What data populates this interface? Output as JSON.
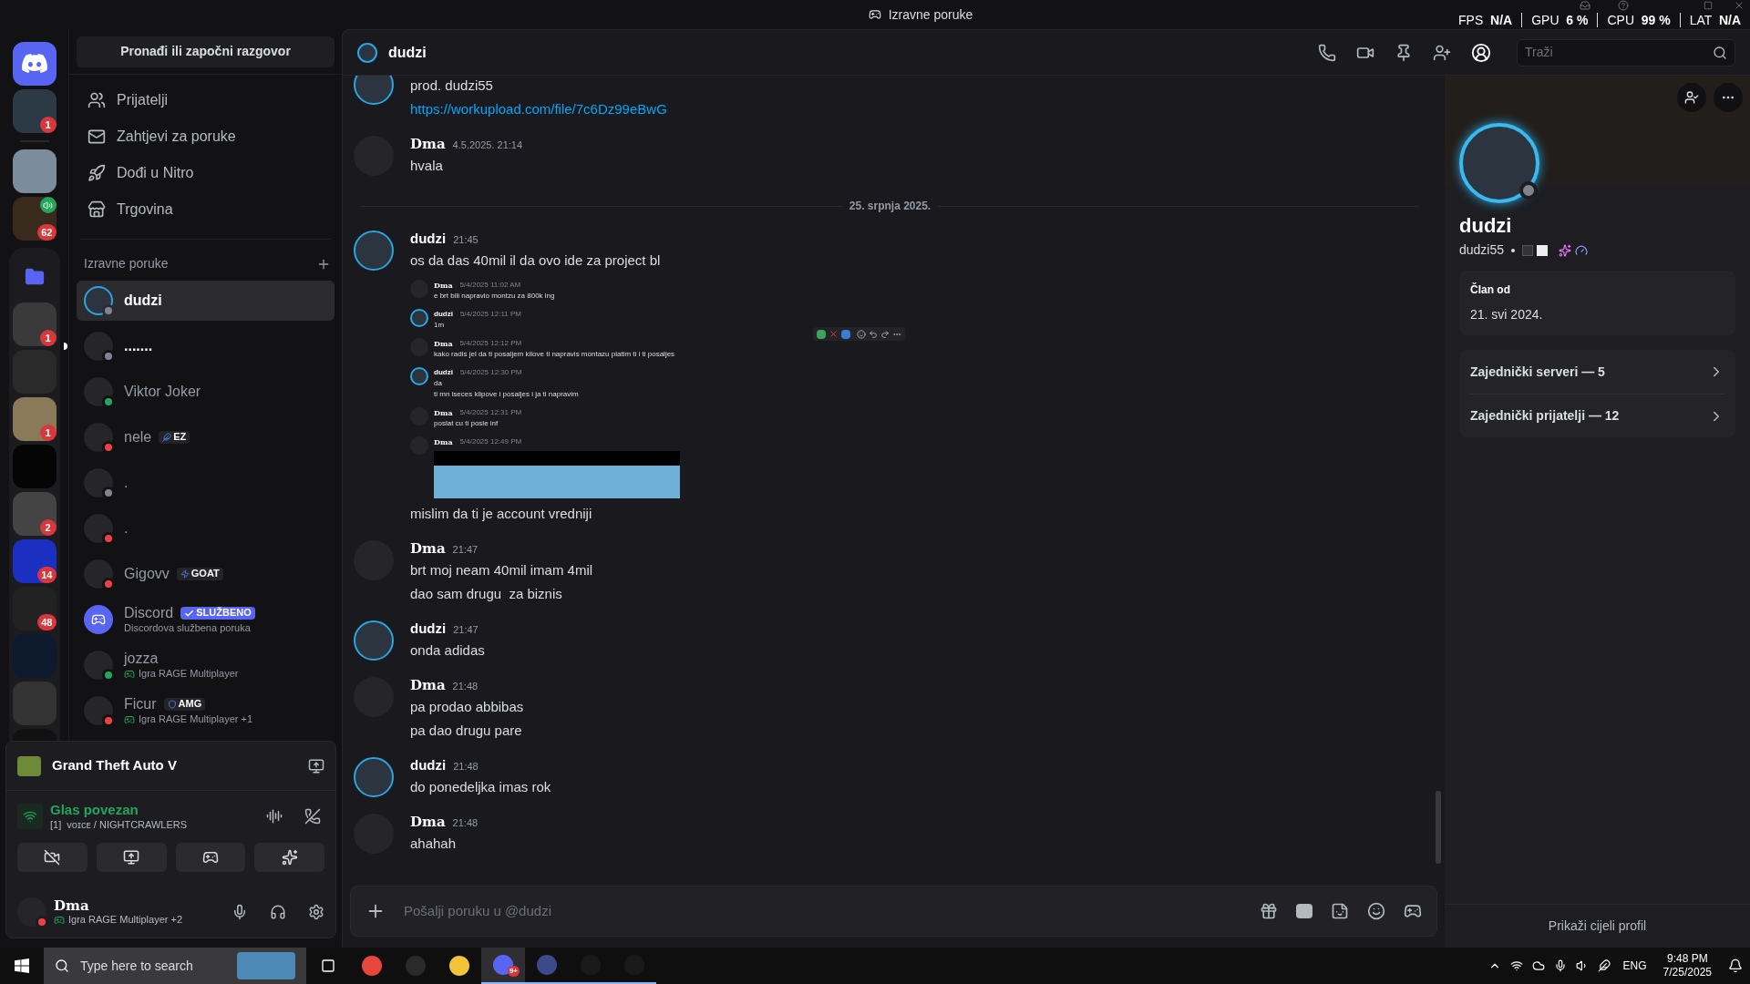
{
  "title_bar": {
    "title": "Izravne poruke"
  },
  "overlay": [
    {
      "label": "FPS",
      "value": "N/A"
    },
    {
      "label": "GPU",
      "value": "6 %"
    },
    {
      "label": "CPU",
      "value": "99 %"
    },
    {
      "label": "LAT",
      "value": "N/A"
    }
  ],
  "servers": [
    {
      "badge": "1",
      "voice": false,
      "color": "#2b3a44"
    },
    {
      "voice": false,
      "color": "#7c8c9c"
    },
    {
      "badge": "62",
      "voice": true,
      "color": "#3a2a1e"
    }
  ],
  "folder": {
    "servers": [
      {
        "badge": "1",
        "voice": false,
        "color": "#3a3a3a"
      },
      {
        "voice": false,
        "color": "#2a2a2a"
      },
      {
        "badge": "1",
        "voice": false,
        "color": "#8a7a5a"
      },
      {
        "voice": false,
        "color": "#050505"
      },
      {
        "badge": "2",
        "voice": false,
        "color": "#444444"
      },
      {
        "badge": "14",
        "voice": false,
        "color": "#1b2fc0"
      },
      {
        "badge": "48",
        "voice": false,
        "color": "#222222"
      },
      {
        "voice": false,
        "color": "#0d1a2e"
      },
      {
        "voice": false,
        "color": "#333333"
      },
      {
        "voice": false,
        "color": "#111111"
      }
    ]
  },
  "dm_panel": {
    "search_button": "Pronađi ili započni razgovor",
    "nav": [
      {
        "label": "Prijatelji"
      },
      {
        "label": "Zahtjevi za poruke"
      },
      {
        "label": "Dođi u Nitro"
      },
      {
        "label": "Trgovina"
      }
    ],
    "section_title": "Izravne poruke",
    "conversations": [
      {
        "name": "dudzi",
        "selected": true,
        "unread": false,
        "color": "#80848e",
        "ring": true
      },
      {
        "name": ".......",
        "selected": false,
        "unread": true,
        "color": "#80848e",
        "ring": false
      },
      {
        "name": "Viktor Joker",
        "selected": false,
        "unread": false,
        "color": "#23a55a",
        "ring": false
      },
      {
        "name": "nele",
        "selected": false,
        "unread": false,
        "color": "#f23f43",
        "ring": false,
        "tag": {
          "kind": "guild",
          "text": "EZ"
        }
      },
      {
        "name": ".",
        "selected": false,
        "unread": false,
        "color": "#80848e",
        "ring": false
      },
      {
        "name": ".",
        "selected": false,
        "unread": false,
        "color": "#f23f43",
        "ring": false
      },
      {
        "name": "Gigovv",
        "selected": false,
        "unread": false,
        "color": "#f23f43",
        "ring": false,
        "tag": {
          "kind": "guild",
          "text": "GOAT"
        }
      },
      {
        "name": "Discord",
        "selected": false,
        "unread": false,
        "tag": {
          "kind": "official",
          "text": "SLUŽBENO"
        },
        "subtitle": "Discordova službena poruka"
      },
      {
        "name": "jozza",
        "selected": false,
        "unread": false,
        "color": "#23a55a",
        "ring": false,
        "activity": "Igra RAGE Multiplayer"
      },
      {
        "name": "Ficur",
        "selected": false,
        "unread": false,
        "color": "#f23f43",
        "ring": false,
        "tag": {
          "kind": "guild",
          "text": "AMG"
        },
        "activity": "Igra RAGE Multiplayer +1"
      }
    ]
  },
  "activity_panel": {
    "game": "Grand Theft Auto V",
    "voice_status": "Glas povezan",
    "channel": "[1]  ᴠᴏɪᴄᴇ / NIGHTCRAWLERS"
  },
  "user_panel": {
    "name": "Dma",
    "color": "#f23f43",
    "activity": "Igra RAGE Multiplayer +2"
  },
  "chat": {
    "header": {
      "name": "dudzi",
      "search_placeholder": "Traži"
    },
    "groups": [
      {
        "kind": "continued",
        "ring": true,
        "lines": [
          {
            "kind": "text",
            "text": "prod. dudzi55"
          },
          {
            "kind": "link",
            "text": "https://workupload.com/file/7c6Dz99eBwG"
          }
        ]
      },
      {
        "kind": "message",
        "author": "Dma",
        "fancy": true,
        "ring": false,
        "time": "4.5.2025. 21:14",
        "lines": [
          {
            "kind": "text",
            "text": "hvala"
          }
        ]
      },
      {
        "kind": "divider",
        "text": "25. srpnja 2025."
      },
      {
        "kind": "message",
        "author": "dudzi",
        "fancy": false,
        "ring": true,
        "time": "21:45",
        "lines": [
          {
            "kind": "text",
            "text": "os da das 40mil il da ovo ide za project bl"
          },
          {
            "kind": "screenshot",
            "messages": [
              {
                "author": "Dma",
                "fancy": true,
                "ring": false,
                "time": "5/4/2025 11:02 AM",
                "lines": [
                  "e brt bili napravio montzu za 800k ing"
                ]
              },
              {
                "author": "dudzi",
                "fancy": false,
                "ring": true,
                "time": "5/4/2025 12:11 PM",
                "lines": [
                  "1m"
                ]
              },
              {
                "author": "Dma",
                "fancy": true,
                "ring": false,
                "time": "5/4/2025 12:12 PM",
                "lines": [
                  "kako radis jel da ti posaljem kilove ti napravis montazu platim ti i ti posaljes"
                ]
              },
              {
                "author": "dudzi",
                "fancy": false,
                "ring": true,
                "time": "5/4/2025 12:30 PM",
                "lines": [
                  "da",
                  "ti mn iseces klipove i posaljes i ja ti napravim"
                ]
              },
              {
                "author": "Dma",
                "fancy": true,
                "ring": false,
                "time": "5/4/2025 12:31 PM",
                "lines": [
                  "poslat cu ti posle inf"
                ]
              },
              {
                "author": "Dma",
                "fancy": true,
                "ring": false,
                "time": "5/4/2025 12:49 PM",
                "image": true
              }
            ]
          },
          {
            "kind": "text",
            "text": "mislim da ti je account vredniji"
          }
        ]
      },
      {
        "kind": "message",
        "author": "Dma",
        "fancy": true,
        "ring": false,
        "time": "21:47",
        "lines": [
          {
            "kind": "text",
            "text": "brt moj neam 40mil imam 4mil"
          },
          {
            "kind": "text",
            "text": "dao sam drugu  za biznis"
          }
        ]
      },
      {
        "kind": "message",
        "author": "dudzi",
        "fancy": false,
        "ring": true,
        "time": "21:47",
        "lines": [
          {
            "kind": "text",
            "text": "onda adidas"
          }
        ]
      },
      {
        "kind": "message",
        "author": "Dma",
        "fancy": true,
        "ring": false,
        "time": "21:48",
        "lines": [
          {
            "kind": "text",
            "text": "pa prodao abbibas"
          },
          {
            "kind": "text",
            "text": "pa dao drugu pare"
          }
        ]
      },
      {
        "kind": "message",
        "author": "dudzi",
        "fancy": false,
        "ring": true,
        "time": "21:48",
        "lines": [
          {
            "kind": "text",
            "text": "do ponedeljka imas rok"
          }
        ]
      },
      {
        "kind": "message",
        "author": "Dma",
        "fancy": true,
        "ring": false,
        "time": "21:48",
        "lines": [
          {
            "kind": "text",
            "text": "ahahah"
          }
        ]
      }
    ],
    "input_placeholder": "Pošalji poruku u @dudzi"
  },
  "profile": {
    "name": "dudzi",
    "username": "dudzi55",
    "member_since_label": "Član od",
    "member_since": "21. svi 2024.",
    "rows": [
      {
        "label": "Zajednički serveri — 5"
      },
      {
        "label": "Zajednički prijatelji — 12"
      }
    ],
    "footer": "Prikaži cijeli profil"
  },
  "taskbar": {
    "search_placeholder": "Type here to search",
    "apps": [
      {
        "active": false,
        "open": false,
        "color": "#e8453c"
      },
      {
        "active": false,
        "open": false,
        "color": "#2a2a2a"
      },
      {
        "active": false,
        "open": false,
        "color": "#f3c43a"
      },
      {
        "active": true,
        "open": true,
        "color": "#5865f2",
        "badge": "9+"
      },
      {
        "active": false,
        "open": true,
        "color": "#3b4a8a"
      },
      {
        "active": false,
        "open": true,
        "color": "#1a1a1a"
      },
      {
        "active": false,
        "open": true,
        "color": "#1a1a1a"
      }
    ],
    "language": "ENG",
    "time": "9:48 PM",
    "date": "7/25/2025"
  }
}
